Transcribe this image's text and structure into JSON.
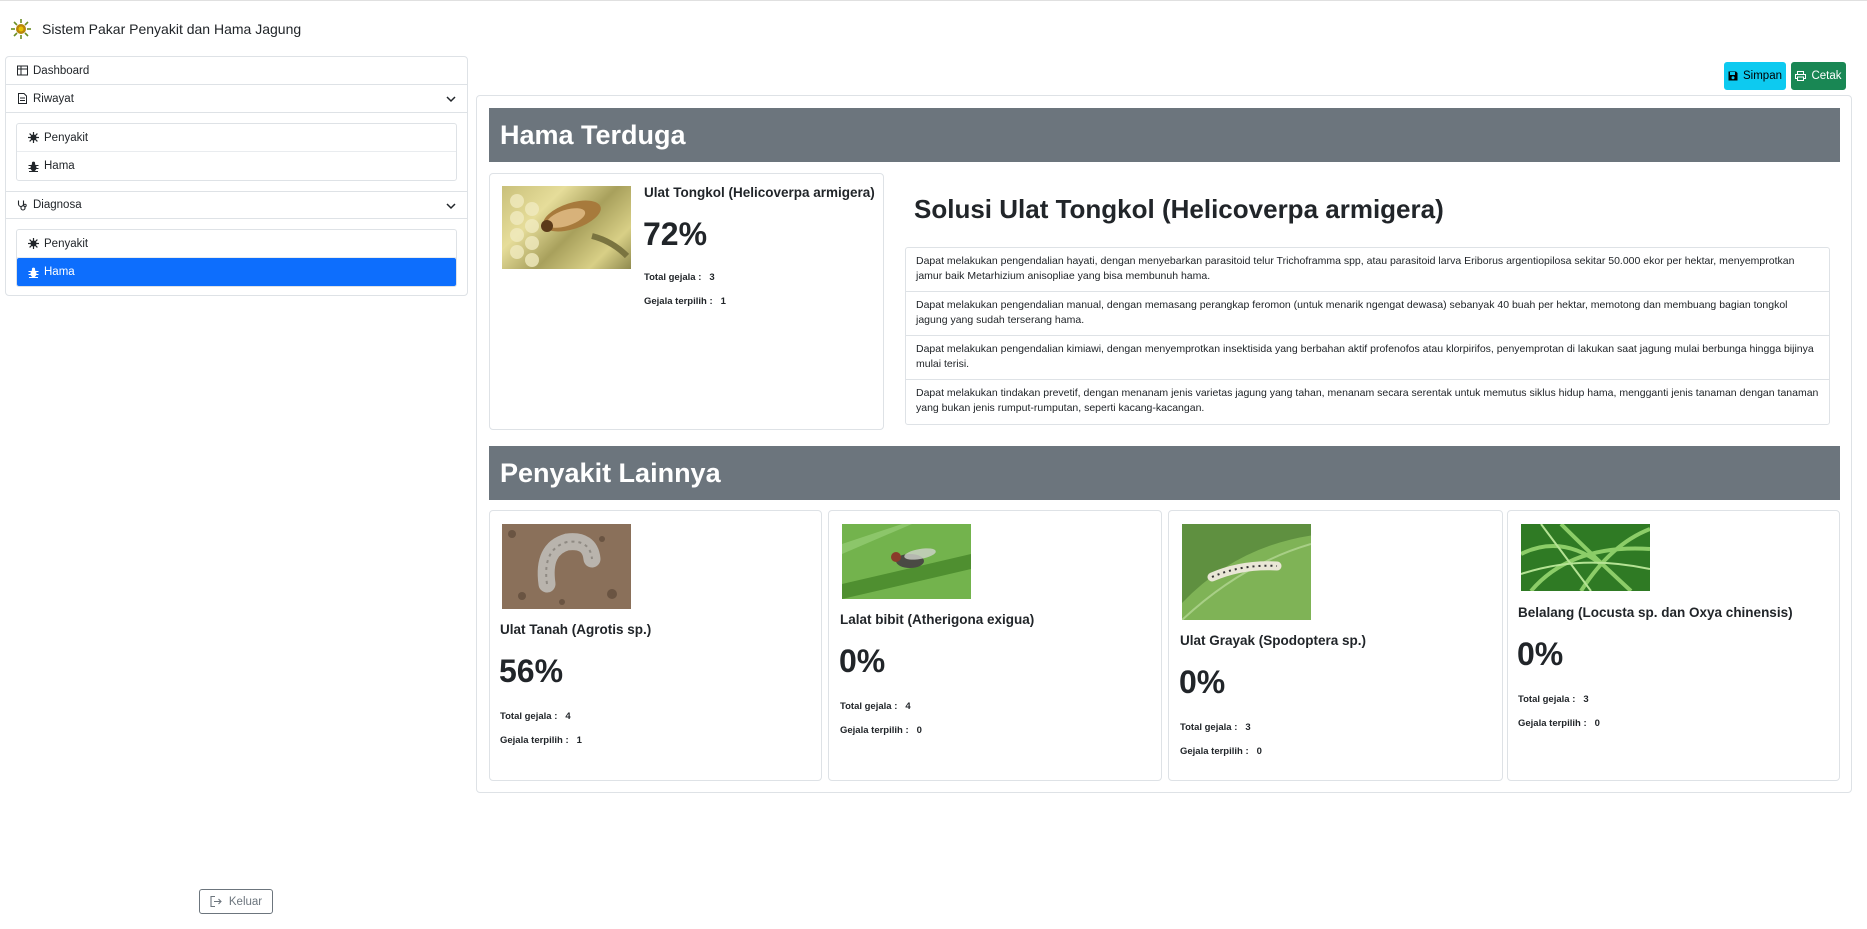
{
  "app": {
    "title": "Sistem Pakar Penyakit dan Hama Jagung"
  },
  "sidebar": {
    "dashboard": "Dashboard",
    "riwayat": {
      "label": "Riwayat",
      "items": [
        "Penyakit",
        "Hama"
      ]
    },
    "diagnosa": {
      "label": "Diagnosa",
      "items": [
        "Penyakit",
        "Hama"
      ],
      "active_item": "Hama"
    },
    "logout": "Keluar"
  },
  "toolbar": {
    "save": "Simpan",
    "print": "Cetak"
  },
  "suspected": {
    "header": "Hama Terduga",
    "name": "Ulat Tongkol (Helicoverpa armigera)",
    "percent": "72%",
    "total_label": "Total gejala :",
    "total": "3",
    "selected_label": "Gejala terpilih :",
    "selected": "1"
  },
  "solution": {
    "title": "Solusi Ulat Tongkol (Helicoverpa armigera)",
    "items": [
      "Dapat melakukan pengendalian hayati, dengan menyebarkan parasitoid telur Trichoframma spp, atau parasitoid larva Eriborus argentiopilosa sekitar 50.000 ekor per hektar, menyemprotkan jamur baik Metarhizium anisopliae yang bisa membunuh hama.",
      "Dapat melakukan pengendalian manual, dengan memasang perangkap feromon (untuk menarik ngengat dewasa) sebanyak 40 buah per hektar, memotong dan membuang bagian tongkol jagung yang sudah terserang hama.",
      "Dapat melakukan pengendalian kimiawi, dengan menyemprotkan insektisida yang berbahan aktif profenofos atau klorpirifos, penyemprotan di lakukan saat jagung mulai berbunga hingga bijinya mulai terisi.",
      "Dapat melakukan tindakan prevetif, dengan menanam jenis varietas jagung yang tahan, menanam secara serentak untuk memutus siklus hidup hama, mengganti jenis tanaman dengan tanaman yang bukan jenis rumput-rumputan, seperti kacang-kacangan."
    ]
  },
  "others": {
    "header": "Penyakit Lainnya",
    "total_label": "Total gejala :",
    "selected_label": "Gejala terpilih :",
    "cards": [
      {
        "name": "Ulat Tanah (Agrotis sp.)",
        "percent": "56%",
        "total": "4",
        "selected": "1"
      },
      {
        "name": "Lalat bibit (Atherigona exigua)",
        "percent": "0%",
        "total": "4",
        "selected": "0"
      },
      {
        "name": "Ulat Grayak (Spodoptera sp.)",
        "percent": "0%",
        "total": "3",
        "selected": "0"
      },
      {
        "name": "Belalang (Locusta sp. dan Oxya chinensis)",
        "percent": "0%",
        "total": "3",
        "selected": "0"
      }
    ]
  }
}
